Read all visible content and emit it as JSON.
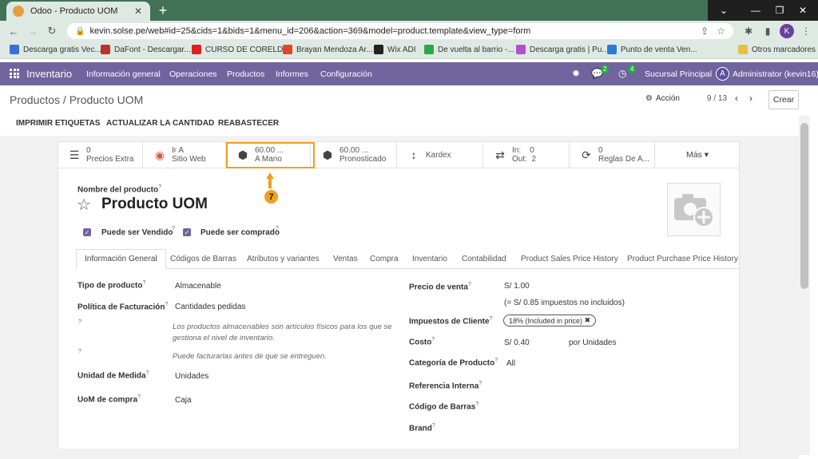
{
  "browser": {
    "tab_title": "Odoo - Producto UOM",
    "tab_close": "✕",
    "new_tab": "+",
    "window_controls": [
      "⌄",
      "—",
      "❐",
      "✕"
    ],
    "url": "kevin.solse.pe/web#id=25&cids=1&bids=1&menu_id=206&action=369&model=product.template&view_type=form",
    "profile_initial": "K",
    "bookmarks": [
      {
        "label": "Descarga gratis Vec...",
        "color": "#3a6fd8"
      },
      {
        "label": "DaFont - Descargar...",
        "color": "#c0302a"
      },
      {
        "label": "CURSO DE CORELD...",
        "color": "#e02020"
      },
      {
        "label": "Brayan Mendoza Ar...",
        "color": "#e24329"
      },
      {
        "label": "Wix ADI",
        "color": "#222222"
      },
      {
        "label": "De vuelta al barrio -...",
        "color": "#2aa84a"
      },
      {
        "label": "Descarga gratis | Pu...",
        "color": "#b04fd0"
      },
      {
        "label": "Punto de venta Ven...",
        "color": "#2a7ad8"
      },
      {
        "label": "Otros marcadores",
        "color": "#e8c040"
      }
    ]
  },
  "navbar": {
    "app": "Inventario",
    "menus": [
      "Información general",
      "Operaciones",
      "Productos",
      "Informes",
      "Configuración"
    ],
    "messages_count": "2",
    "activities_count": "4",
    "company": "Sucursal Principal",
    "user_initial": "A",
    "user": "Administrator (kevin16)",
    "bg": "#71639e"
  },
  "control": {
    "breadcrumb": "Productos / Producto UOM",
    "action": "Acción",
    "pager": "9 / 13",
    "create": "Crear"
  },
  "header_buttons": [
    "IMPRIMIR ETIQUETAS",
    "ACTUALIZAR LA CANTIDAD",
    "REABASTECER"
  ],
  "smart_buttons": [
    {
      "icon": "list-icon",
      "value": "0",
      "label": "Precios Extra"
    },
    {
      "icon": "globe-icon",
      "value": "Ir A",
      "label": "Sitio Web"
    },
    {
      "icon": "cubes-icon",
      "value": "60.00 ...",
      "label": "A Mano"
    },
    {
      "icon": "cubes-icon",
      "value": "60.00 ...",
      "label": "Pronosticado"
    },
    {
      "icon": "arrows-v-icon",
      "value": "",
      "label": "Kardex"
    },
    {
      "icon": "exchange-icon",
      "in_label": "In:",
      "in_value": "0",
      "out_label": "Out:",
      "out_value": "2"
    },
    {
      "icon": "refresh-icon",
      "value": "0",
      "label": "Reglas De A..."
    },
    {
      "label": "Más"
    }
  ],
  "callout": "7",
  "product": {
    "name_label": "Nombre del producto",
    "help_mark": "?",
    "name": "Producto UOM",
    "can_be_sold": "Puede ser Vendido",
    "can_be_purchased": "Puede ser comprado"
  },
  "tabs": [
    "Información General",
    "Códigos de Barras",
    "Atributos y variantes",
    "Ventas",
    "Compra",
    "Inventario",
    "Contabilidad",
    "Product Sales Price History",
    "Product Purchase Price History"
  ],
  "left_fields": {
    "tipo_label": "Tipo de producto",
    "tipo_value": "Almacenable",
    "politica_label": "Política de Facturación",
    "politica_value": "Cantidades pedidas",
    "help1": "Los productos almacenables son artículos físicos para los que se gestiona el nivel de inventario.",
    "help2": "Puede facturarlas antes de que se entreguen.",
    "uom_label": "Unidad de Medida",
    "uom_value": "Unidades",
    "uom_po_label": "UoM de compra",
    "uom_po_value": "Caja"
  },
  "right_fields": {
    "precio_label": "Precio de venta",
    "precio_value": "S/ 1.00",
    "precio_note": "(= S/ 0.85 impuestos no incluidos)",
    "impuestos_label": "Impuestos de Cliente",
    "impuestos_tag": "18% (Included in price)",
    "tag_remove": "✖",
    "costo_label": "Costo",
    "costo_value": "S/ 0.40",
    "costo_unit": "por Unidades",
    "categoria_label": "Categoría de Producto",
    "categoria_value": "All",
    "ref_label": "Referencia Interna",
    "barcode_label": "Código de Barras",
    "brand_label": "Brand"
  }
}
